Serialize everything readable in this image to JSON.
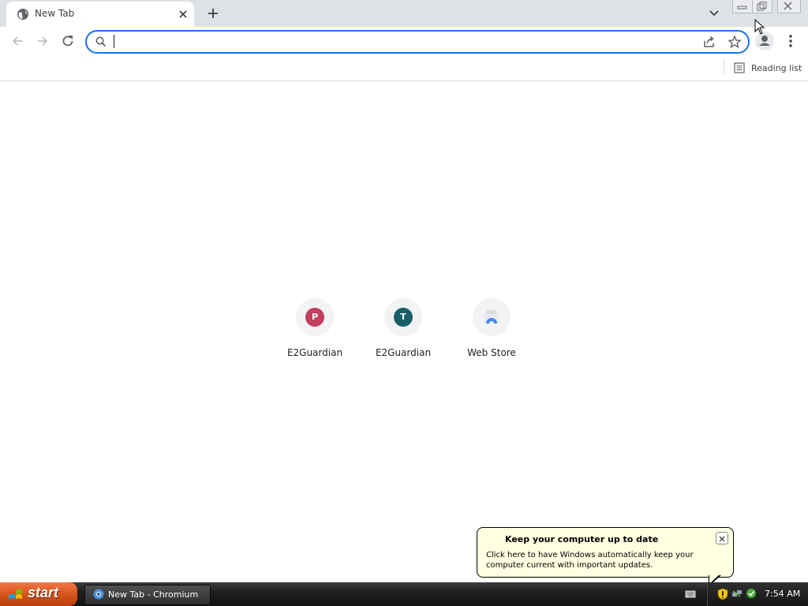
{
  "browser": {
    "tab": {
      "title": "New Tab"
    },
    "omnibox": {
      "value": "",
      "placeholder": ""
    },
    "bookmarks_bar": {
      "reading_list_label": "Reading list"
    }
  },
  "new_tab_page": {
    "shortcuts": [
      {
        "letter": "P",
        "label": "E2Guardian",
        "color": "#c2405f"
      },
      {
        "letter": "T",
        "label": "E2Guardian",
        "color": "#1a5f67"
      },
      {
        "letter": "",
        "label": "Web Store",
        "color": "#4285f4"
      }
    ]
  },
  "notification_balloon": {
    "title": "Keep your computer up to date",
    "text": "Click here to have Windows automatically keep your computer current with important updates."
  },
  "taskbar": {
    "start_label": "start",
    "task_item_label": "New Tab - Chromium",
    "clock": "7:54 AM"
  },
  "colors": {
    "accent": "#1a73e8",
    "tabstrip": "#dee1e6",
    "balloon_bg": "#ffffe1",
    "start_button": "#d8541d"
  }
}
